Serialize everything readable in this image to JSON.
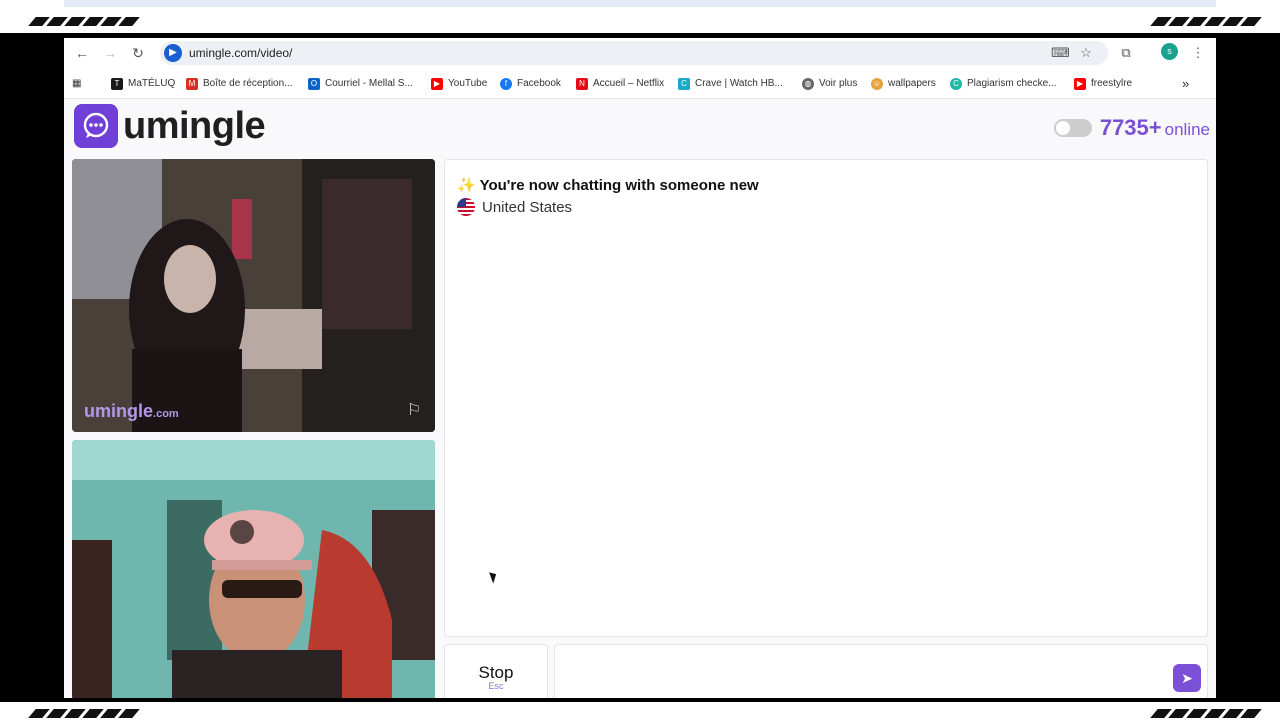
{
  "browser": {
    "url": "umingle.com/video/",
    "bookmarks": [
      {
        "label": "MaTÉLUQ",
        "icon": "teluq-icon",
        "color": "#1a1a1a"
      },
      {
        "label": "Boîte de réception...",
        "icon": "gmail-icon",
        "color": "#d93025"
      },
      {
        "label": "Courriel - Mellal S...",
        "icon": "outlook-icon",
        "color": "#0a64c8"
      },
      {
        "label": "YouTube",
        "icon": "youtube-icon",
        "color": "#ff0000"
      },
      {
        "label": "Facebook",
        "icon": "facebook-icon",
        "color": "#1877f2"
      },
      {
        "label": "Accueil – Netflix",
        "icon": "netflix-icon",
        "color": "#e50914"
      },
      {
        "label": "Crave | Watch HB...",
        "icon": "crave-icon",
        "color": "#17a9c6"
      },
      {
        "label": "Voir plus",
        "icon": "globe-icon",
        "color": "#666666"
      },
      {
        "label": "wallpapers",
        "icon": "wallpapers-icon",
        "color": "#e8a23a"
      },
      {
        "label": "Plagiarism checke...",
        "icon": "plagiarism-icon",
        "color": "#1fb6a6"
      },
      {
        "label": "freestylre",
        "icon": "youtube-icon",
        "color": "#ff0000"
      }
    ],
    "profile_initial": "s"
  },
  "header": {
    "logo_text": "umingle",
    "online_count": "7735+",
    "online_label": "online"
  },
  "video": {
    "watermark": "umingle",
    "watermark_suffix": ".com"
  },
  "chat": {
    "status_message": "✨ You're now chatting with someone new",
    "country": "United States",
    "input_value": ""
  },
  "controls": {
    "stop_label": "Stop",
    "stop_key": "Esc"
  },
  "colors": {
    "brand": "#7b4fd6",
    "logo_box": "#6f3fd8"
  }
}
